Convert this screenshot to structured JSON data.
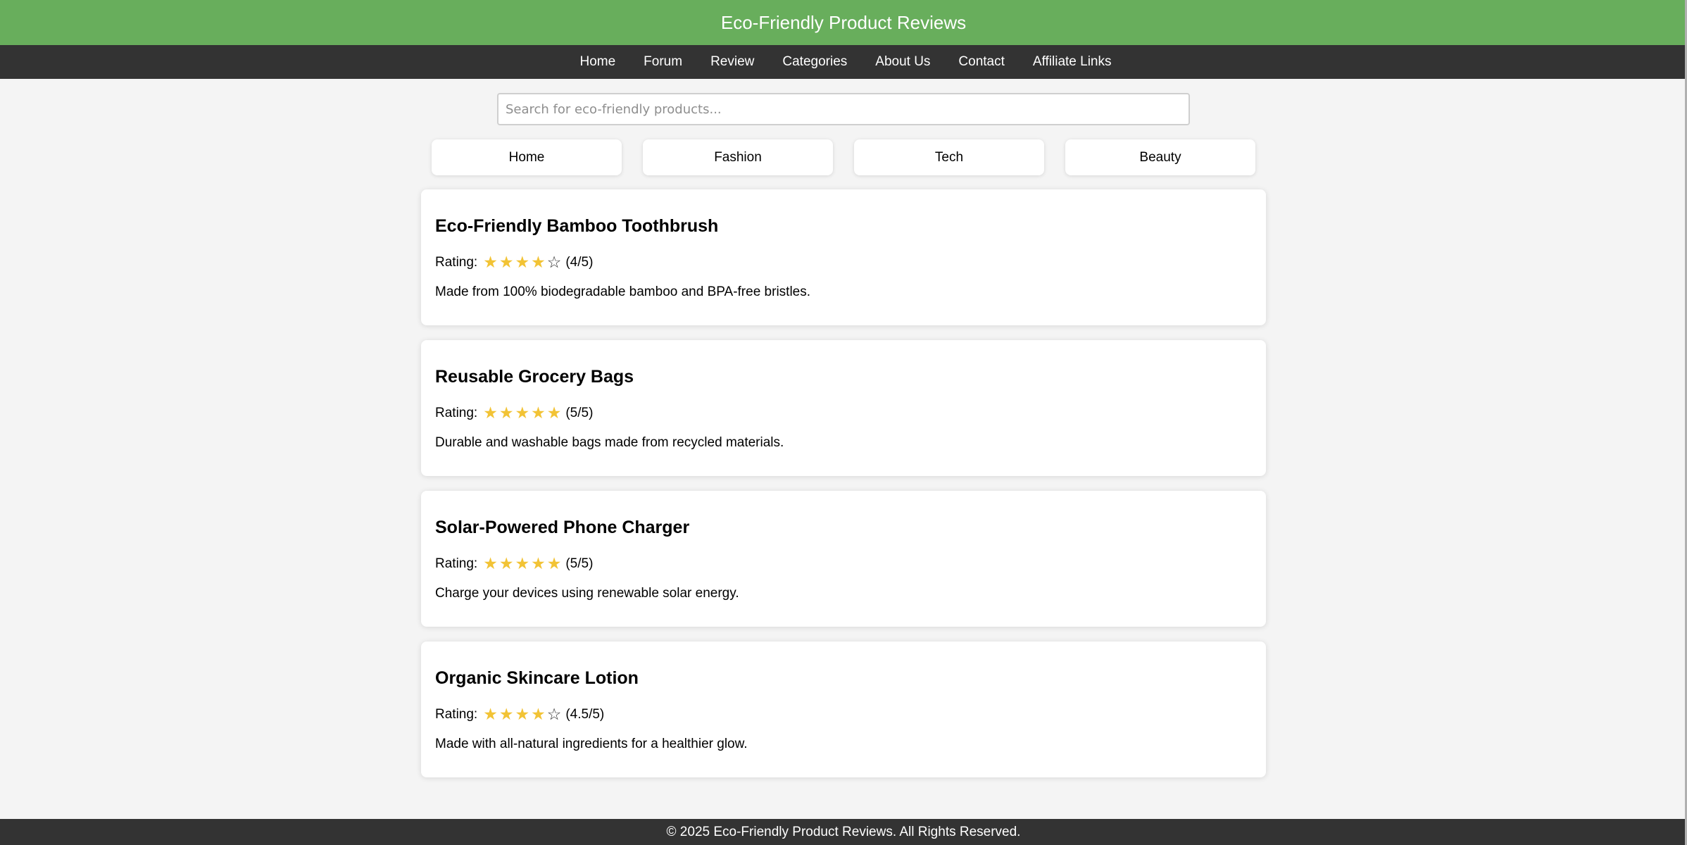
{
  "header": {
    "title": "Eco-Friendly Product Reviews"
  },
  "nav": [
    "Home",
    "Forum",
    "Review",
    "Categories",
    "About Us",
    "Contact",
    "Affiliate Links"
  ],
  "search": {
    "placeholder": "Search for eco-friendly products...",
    "value": ""
  },
  "categories": [
    "Home",
    "Fashion",
    "Tech",
    "Beauty"
  ],
  "reviews": [
    {
      "title": "Eco-Friendly Bamboo Toothbrush",
      "rating_label": "Rating:",
      "rating": 4,
      "rating_text": "(4/5)",
      "description": "Made from 100% biodegradable bamboo and BPA-free bristles."
    },
    {
      "title": "Reusable Grocery Bags",
      "rating_label": "Rating:",
      "rating": 5,
      "rating_text": "(5/5)",
      "description": "Durable and washable bags made from recycled materials."
    },
    {
      "title": "Solar-Powered Phone Charger",
      "rating_label": "Rating:",
      "rating": 5,
      "rating_text": "(5/5)",
      "description": "Charge your devices using renewable solar energy."
    },
    {
      "title": "Organic Skincare Lotion",
      "rating_label": "Rating:",
      "rating": 4.5,
      "rating_text": "(4.5/5)",
      "description": "Made with all-natural ingredients for a healthier glow."
    }
  ],
  "footer": {
    "text": "© 2025 Eco-Friendly Product Reviews. All Rights Reserved."
  },
  "colors": {
    "header": "#68ae5c",
    "nav": "#333333",
    "background": "#f4f4f4",
    "star": "#f2c335"
  }
}
